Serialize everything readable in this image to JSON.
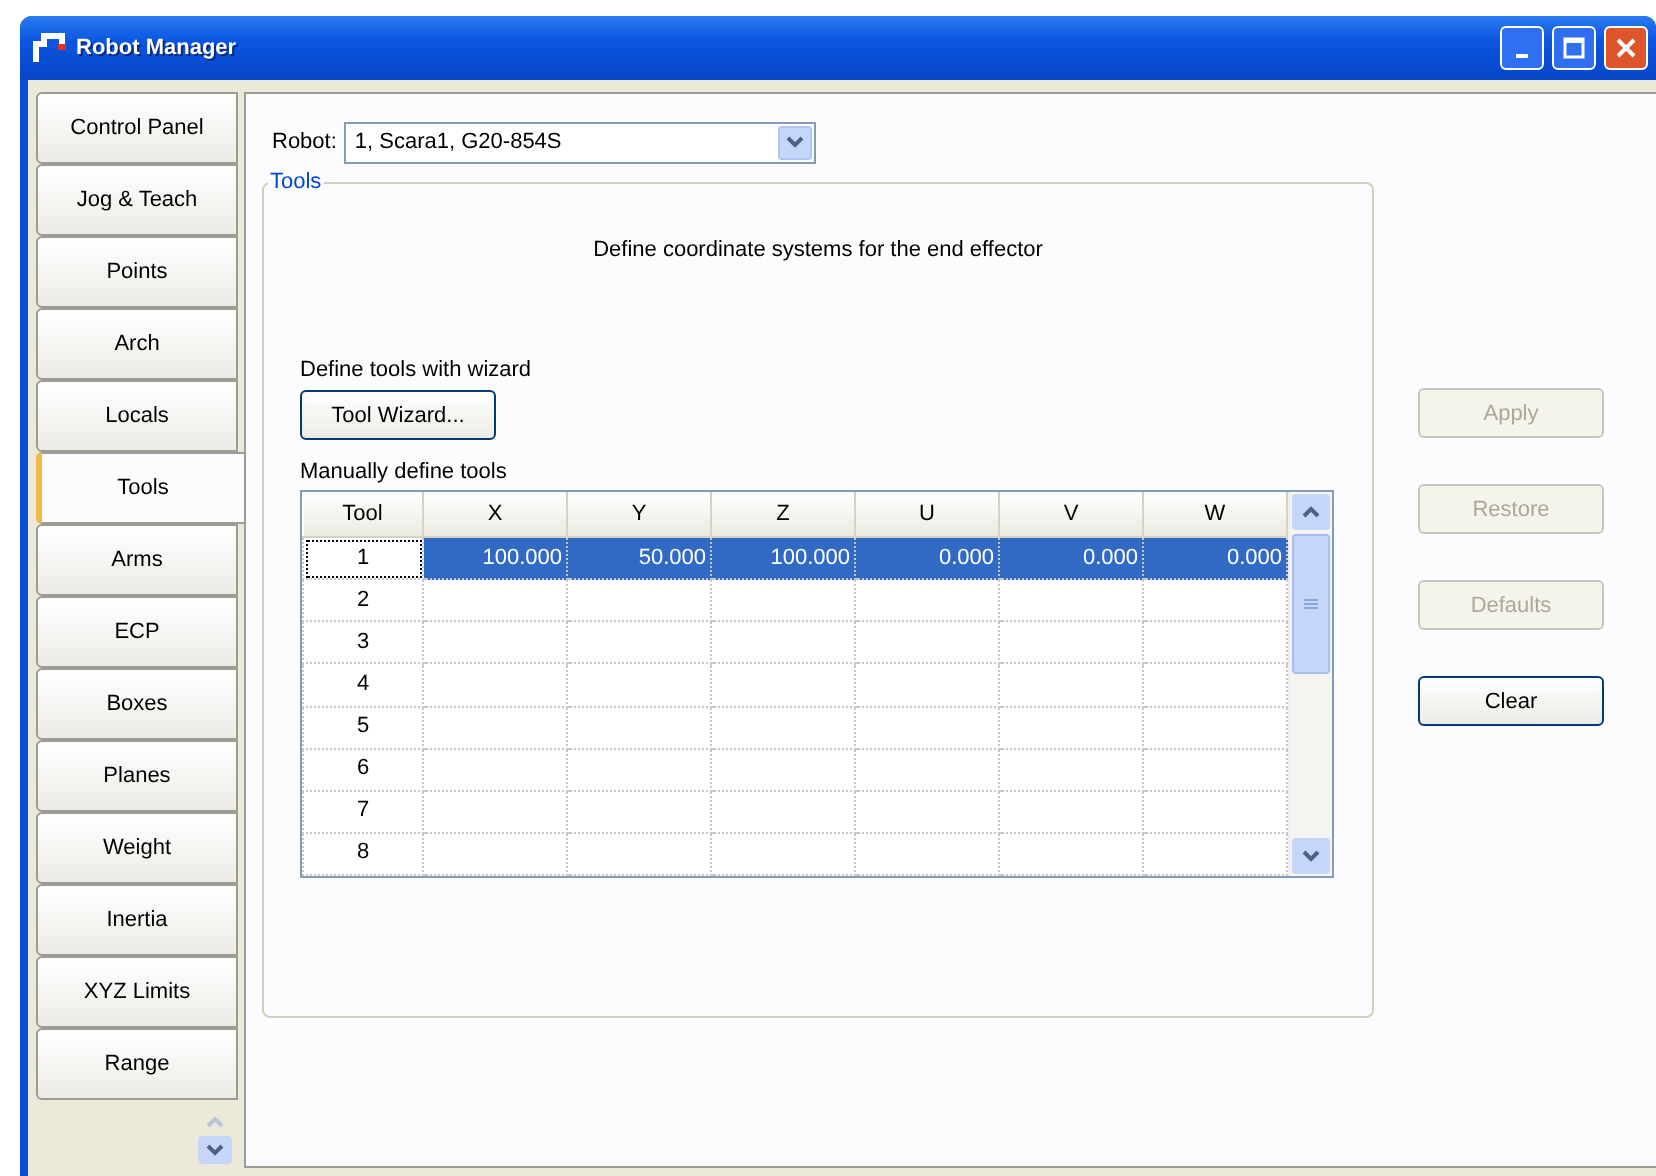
{
  "window": {
    "title": "Robot Manager"
  },
  "tabs": [
    {
      "label": "Control Panel",
      "selected": false
    },
    {
      "label": "Jog & Teach",
      "selected": false
    },
    {
      "label": "Points",
      "selected": false
    },
    {
      "label": "Arch",
      "selected": false
    },
    {
      "label": "Locals",
      "selected": false
    },
    {
      "label": "Tools",
      "selected": true
    },
    {
      "label": "Arms",
      "selected": false
    },
    {
      "label": "ECP",
      "selected": false
    },
    {
      "label": "Boxes",
      "selected": false
    },
    {
      "label": "Planes",
      "selected": false
    },
    {
      "label": "Weight",
      "selected": false
    },
    {
      "label": "Inertia",
      "selected": false
    },
    {
      "label": "XYZ Limits",
      "selected": false
    },
    {
      "label": "Range",
      "selected": false
    }
  ],
  "robot": {
    "label": "Robot:",
    "value": "1, Scara1, G20-854S"
  },
  "group": {
    "title": "Tools",
    "description": "Define coordinate systems for the end effector",
    "wizard_label": "Define tools with wizard",
    "wizard_button": "Tool Wizard...",
    "manual_label": "Manually define tools"
  },
  "table": {
    "columns": [
      "Tool",
      "X",
      "Y",
      "Z",
      "U",
      "V",
      "W"
    ],
    "rows": [
      {
        "cells": [
          "1",
          "100.000",
          "50.000",
          "100.000",
          "0.000",
          "0.000",
          "0.000"
        ],
        "selected": true
      },
      {
        "cells": [
          "2"
        ],
        "selected": false
      },
      {
        "cells": [
          "3"
        ],
        "selected": false
      },
      {
        "cells": [
          "4"
        ],
        "selected": false
      },
      {
        "cells": [
          "5"
        ],
        "selected": false
      },
      {
        "cells": [
          "6"
        ],
        "selected": false
      },
      {
        "cells": [
          "7"
        ],
        "selected": false
      },
      {
        "cells": [
          "8"
        ],
        "selected": false
      }
    ]
  },
  "buttons": [
    {
      "label": "Apply",
      "disabled": true
    },
    {
      "label": "Restore",
      "disabled": true
    },
    {
      "label": "Defaults",
      "disabled": true
    },
    {
      "label": "Clear",
      "disabled": false
    }
  ]
}
